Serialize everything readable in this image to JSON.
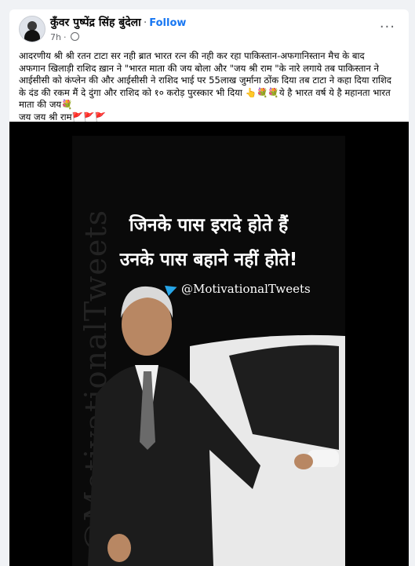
{
  "post": {
    "author": "कुँवर पुष्पेंद्र सिंह बुंदेला",
    "follow_label": "Follow",
    "time": "7h",
    "more": "···",
    "text_lines": [
      "आदरणीय श्री श्री रतन टाटा सर नही ब्रात भारत रत्न की नही कर रहा पाकिस्तान-अफगानिस्तान मैच के बाद",
      "अफगान खिलाड़ी राशिद ख़ान ने \"भारत माता की जय बोला और \"जय श्री राम \"के नारे लगाये तब पाकिस्तान ने",
      "आईसीसी को कंप्लेन की और आईसीसी ने राशिद भाई पर 55लाख जुर्माना ठोंक दिया तब टाटा ने कहा दिया राशिद",
      "के दंड की रकम मैं दे दुंगा और राशिद को १० करोड़ पुरस्कार भी दिया 👆💐💐ये है भारत वर्ष ये है महानता भारत",
      "माता की जय💐",
      "जय जय श्री राम🚩🚩🚩"
    ]
  },
  "image": {
    "quote_line1": "जिनके पास इरादे होते हैं",
    "quote_line2": "उनके पास बहाने नहीं होते!",
    "handle": "@MotivationalTweets",
    "watermark": "@MotivationalTweets",
    "icon": "telegram-icon"
  }
}
